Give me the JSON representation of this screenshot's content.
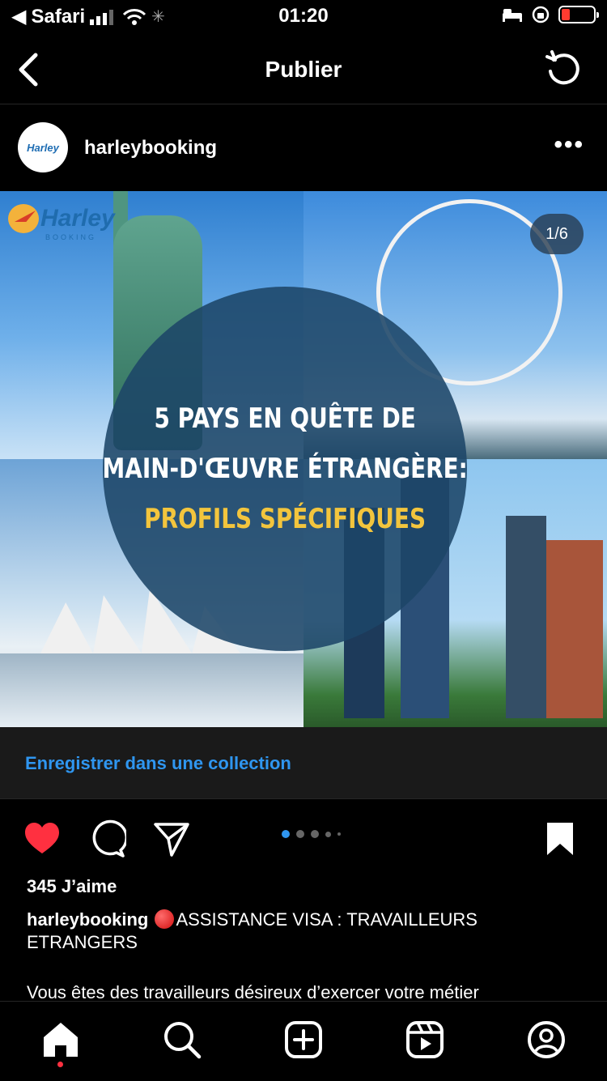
{
  "status_bar": {
    "back_app": "Safari",
    "time": "01:20"
  },
  "nav": {
    "title": "Publier"
  },
  "post": {
    "username": "harleybooking",
    "more_label": "•••",
    "avatar_logo_text": "Harley",
    "image": {
      "logo_text": "Harley",
      "logo_sub": "BOOKING",
      "counter": "1/6",
      "headline_lines": [
        "5 PAYS EN QUÊTE DE",
        "MAIN-D'ŒUVRE ÉTRANGÈRE:",
        "PROFILS SPÉCIFIQUES"
      ]
    },
    "save_collection_label": "Enregistrer dans une collection",
    "carousel": {
      "count": 6,
      "active_index": 0
    },
    "likes": "345 J’aime",
    "caption": {
      "user": "harleybooking",
      "text": "ASSISTANCE VISA : TRAVAILLEURS ETRANGERS",
      "text2": "Vous êtes des travailleurs désireux d’exercer votre métier"
    }
  },
  "tabbar": {
    "items": [
      "home-icon",
      "search-icon",
      "create-icon",
      "reels-icon",
      "profile-icon"
    ],
    "active": "home-icon"
  },
  "colors": {
    "accent": "#2f96f0",
    "like_red": "#ff3040",
    "background": "#000000"
  }
}
